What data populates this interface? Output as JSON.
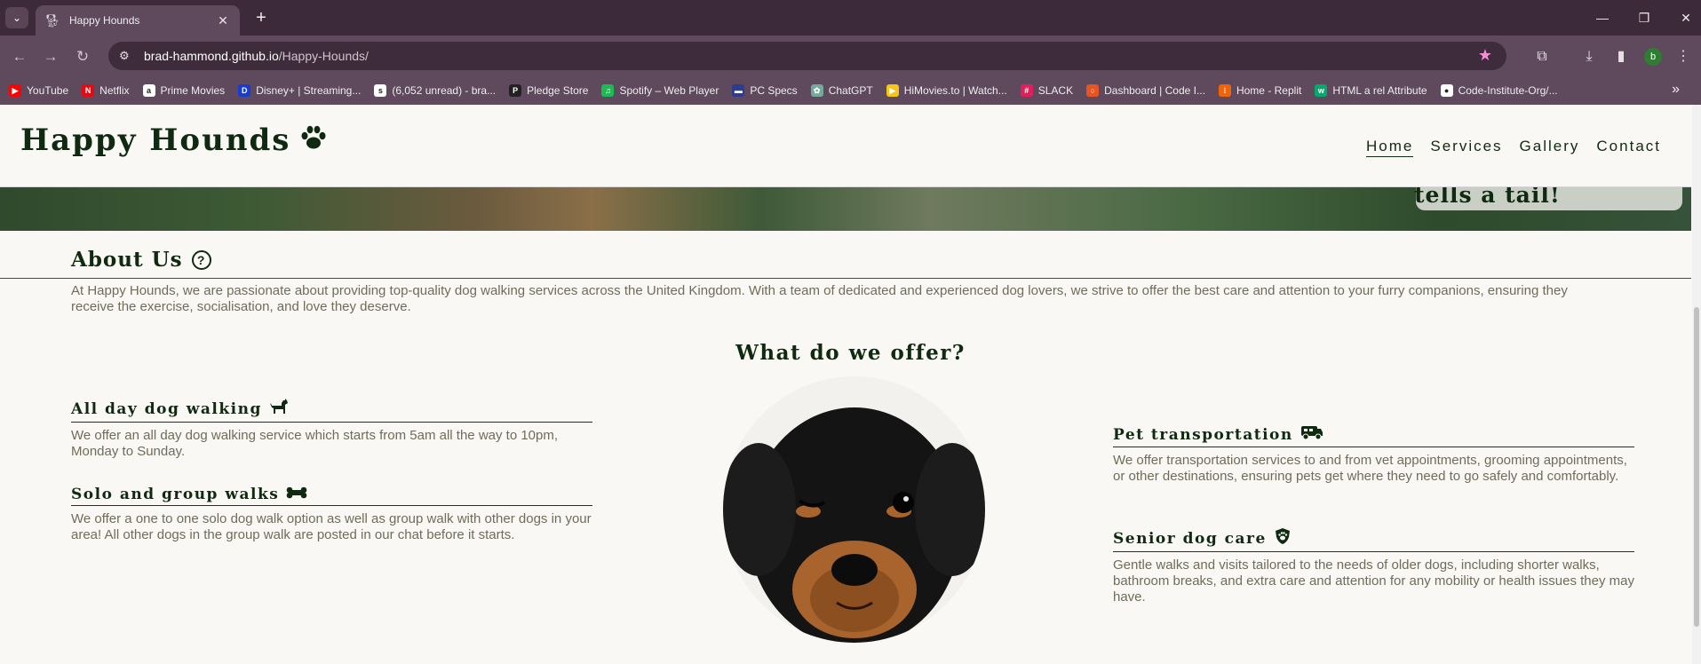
{
  "browser": {
    "tab_title": "Happy Hounds",
    "url_host": "brad-hammond.github.io",
    "url_path": "/Happy-Hounds/",
    "profile_initial": "b",
    "bookmarks": [
      {
        "label": "YouTube",
        "color": "#ff0000",
        "icon": "youtube-icon",
        "glyph": "▶"
      },
      {
        "label": "Netflix",
        "color": "#e50914",
        "icon": "netflix-icon",
        "glyph": "N"
      },
      {
        "label": "Prime Movies",
        "color": "#ffffff",
        "icon": "amazon-icon",
        "glyph": "a"
      },
      {
        "label": "Disney+ | Streaming...",
        "color": "#1a3bd1",
        "icon": "disney-icon",
        "glyph": "D"
      },
      {
        "label": "(6,052 unread) - bra...",
        "color": "#ffffff",
        "icon": "sky-icon",
        "glyph": "s"
      },
      {
        "label": "Pledge Store",
        "color": "#222222",
        "icon": "pledge-icon",
        "glyph": "P"
      },
      {
        "label": "Spotify – Web Player",
        "color": "#1db954",
        "icon": "spotify-icon",
        "glyph": "♫"
      },
      {
        "label": "PC Specs",
        "color": "#2a3d8f",
        "icon": "pcspecs-icon",
        "glyph": "▬"
      },
      {
        "label": "ChatGPT",
        "color": "#74aa9c",
        "icon": "chatgpt-icon",
        "glyph": "✿"
      },
      {
        "label": "HiMovies.to | Watch...",
        "color": "#f5c518",
        "icon": "himovies-icon",
        "glyph": "▶"
      },
      {
        "label": "SLACK",
        "color": "#e01e5a",
        "icon": "slack-icon",
        "glyph": "#"
      },
      {
        "label": "Dashboard | Code I...",
        "color": "#e8531f",
        "icon": "codeinstitute-icon",
        "glyph": "○"
      },
      {
        "label": "Home - Replit",
        "color": "#f26207",
        "icon": "replit-icon",
        "glyph": "⁝"
      },
      {
        "label": "HTML a rel Attribute",
        "color": "#04aa6d",
        "icon": "w3schools-icon",
        "glyph": "w"
      },
      {
        "label": "Code-Institute-Org/...",
        "color": "#ffffff",
        "icon": "github-icon",
        "glyph": "●"
      }
    ]
  },
  "site": {
    "logo": "Happy Hounds",
    "nav": [
      "Home",
      "Services",
      "Gallery",
      "Contact"
    ],
    "hero_text": "tells a tail!",
    "about": {
      "heading": "About Us",
      "body": "At Happy Hounds, we are passionate about providing top-quality dog walking services across the United Kingdom. With a team of dedicated and experienced dog lovers, we strive to offer the best care and attention to your furry companions, ensuring they receive the exercise, socialisation, and love they deserve."
    },
    "offer_heading": "What do we offer?",
    "services": [
      {
        "title": "All day dog walking",
        "icon": "dog-icon",
        "body": "We offer an all day dog walking service which starts from 5am all the way to 10pm, Monday to Sunday."
      },
      {
        "title": "Solo and group walks",
        "icon": "bone-icon",
        "body": "We offer a one to one solo dog walk option as well as group walk with other dogs in your area! All other dogs in the group walk are posted in our chat before it starts."
      },
      {
        "title": "Pet transportation",
        "icon": "van-icon",
        "body": "We offer transportation services to and from vet appointments, grooming appointments, or other destinations, ensuring pets get where they need to go safely and comfortably."
      },
      {
        "title": "Senior dog care",
        "icon": "shield-dog-icon",
        "body": "Gentle walks and visits tailored to the needs of older dogs, including shorter walks, bathroom breaks, and extra care and attention for any mobility or health issues they may have."
      }
    ]
  },
  "colors": {
    "brand_green": "#0f2a10",
    "body_text": "#6f6c5a",
    "chrome": "#5e4a5c"
  }
}
